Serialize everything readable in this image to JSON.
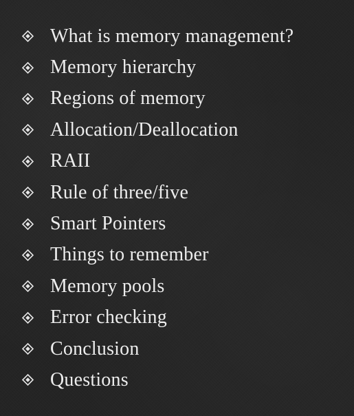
{
  "slide": {
    "bullet_icon": "diamond-dot-bullet-icon",
    "text_color": "#ededed",
    "background_color": "#242424",
    "items": [
      {
        "label": "What is memory management?"
      },
      {
        "label": "Memory hierarchy"
      },
      {
        "label": "Regions of memory"
      },
      {
        "label": "Allocation/Deallocation"
      },
      {
        "label": "RAII"
      },
      {
        "label": "Rule of three/five"
      },
      {
        "label": "Smart Pointers"
      },
      {
        "label": "Things to remember"
      },
      {
        "label": "Memory pools"
      },
      {
        "label": "Error checking"
      },
      {
        "label": "Conclusion"
      },
      {
        "label": "Questions"
      }
    ]
  }
}
